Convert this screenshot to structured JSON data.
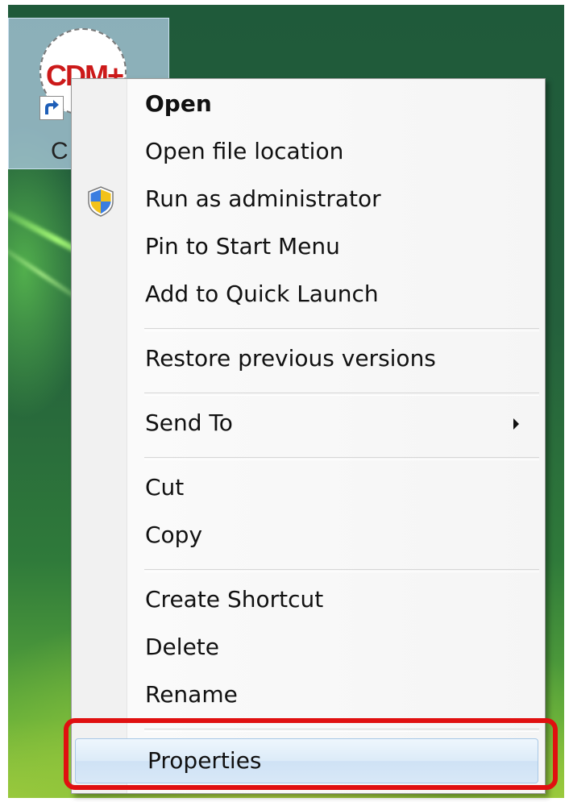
{
  "desktop": {
    "icon": {
      "brand_text": "CDM+",
      "label": "C"
    }
  },
  "context_menu": {
    "items": [
      {
        "label": "Open"
      },
      {
        "label": "Open file location"
      },
      {
        "label": "Run as administrator"
      },
      {
        "label": "Pin to Start Menu"
      },
      {
        "label": "Add to Quick Launch"
      },
      {
        "label": "Restore previous versions"
      },
      {
        "label": "Send To"
      },
      {
        "label": "Cut"
      },
      {
        "label": "Copy"
      },
      {
        "label": "Create Shortcut"
      },
      {
        "label": "Delete"
      },
      {
        "label": "Rename"
      },
      {
        "label": "Properties"
      }
    ],
    "highlighted_item": "Properties"
  },
  "colors": {
    "callout": "#e01010",
    "highlight": "#d8e8f7",
    "brand_red": "#cc1a1a"
  }
}
